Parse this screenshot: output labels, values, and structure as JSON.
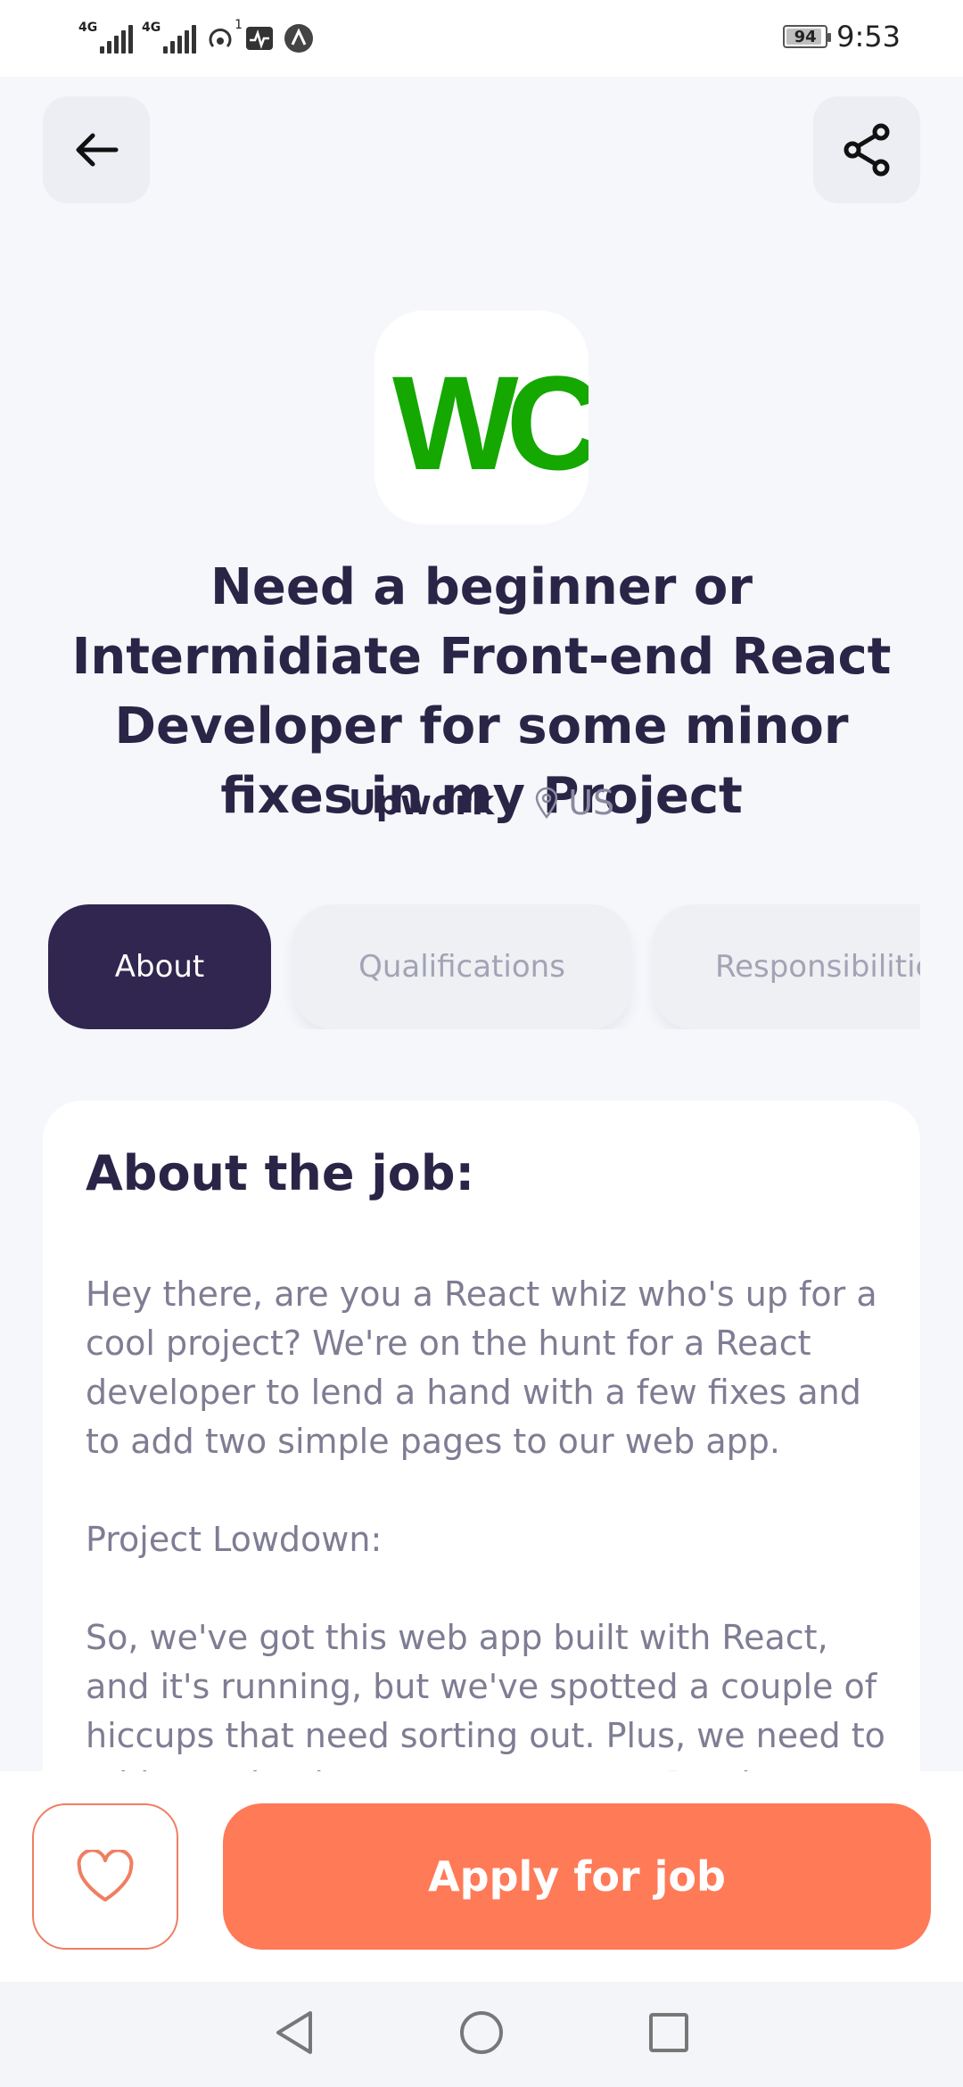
{
  "status_bar": {
    "network_1": "4G",
    "network_2": "4G",
    "hotspot_count": "1",
    "battery_level": "94",
    "battery_fraction": 0.94,
    "time": "9:53"
  },
  "header": {
    "back_icon": "arrow-left-icon",
    "share_icon": "share-icon"
  },
  "job": {
    "logo_text": "WC",
    "logo_color": "#14a800",
    "title": "Need a beginner or Intermidiate Front-end React Developer for some minor fixes in my Project",
    "company": "Upwork /",
    "location": "US"
  },
  "tabs": [
    {
      "label": "About",
      "active": true
    },
    {
      "label": "Qualifications",
      "active": false
    },
    {
      "label": "Responsibilities",
      "active": false
    }
  ],
  "about": {
    "heading": "About the job:",
    "paragraphs": [
      "Hey there, are you a React whiz who's up for a cool project? We're on the hunt for a React developer to lend a hand with a few fixes and to add two simple pages to our web app.",
      "Project Lowdown:",
      "So, we've got this web app built with React, and it's running, but we've spotted a couple of hiccups that need sorting out. Plus, we need to add two simple pages to our app. Ready"
    ]
  },
  "actions": {
    "favorite_icon": "heart-icon",
    "apply_label": "Apply for job"
  },
  "colors": {
    "primary_dark": "#30264f",
    "accent": "#ff7a57",
    "background": "#f6f7fb"
  }
}
